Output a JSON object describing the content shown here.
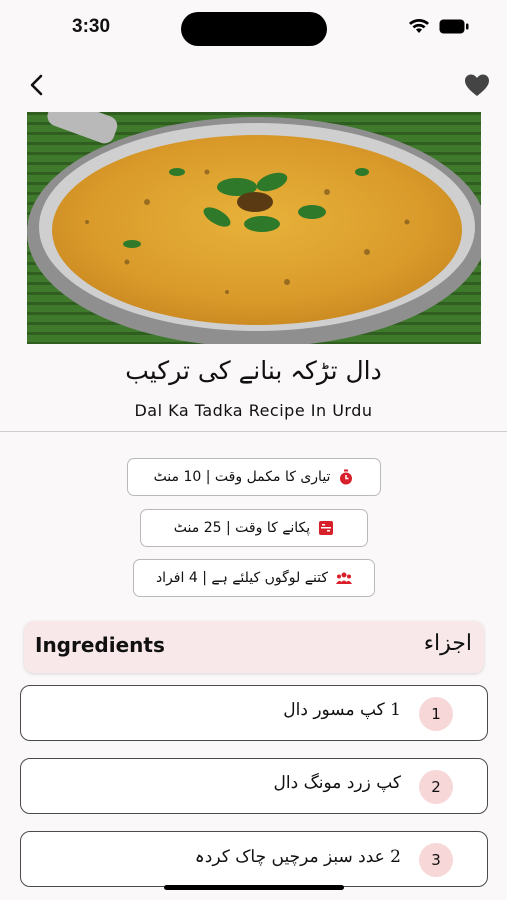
{
  "status_bar": {
    "time": "3:30"
  },
  "recipe": {
    "title_urdu": "دال تڑکہ بنانے کی ترکیب",
    "title_english": "Dal Ka Tadka Recipe In Urdu"
  },
  "info": [
    {
      "text": "تیاری کا مکمل وقت | 10 منٹ",
      "icon": "timer-icon"
    },
    {
      "text": "پکانے کا وقت | 25 منٹ",
      "icon": "cooking-icon"
    },
    {
      "text": "کتنے لوگوں کیلئے ہے | 4 افراد",
      "icon": "people-icon"
    }
  ],
  "ingredients": {
    "header_en": "Ingredients",
    "header_ur": "اجزاء",
    "items": [
      {
        "num": "1",
        "text": "1 کپ مسور دال"
      },
      {
        "num": "2",
        "text": "کپ زرد مونگ دال"
      },
      {
        "num": "3",
        "text": "2 عدد سبز مرچیں چاک کردہ"
      }
    ]
  },
  "colors": {
    "accent_pink": "#f7d7d8",
    "header_bg": "#f8e8ea",
    "icon_red": "#d8202a"
  }
}
